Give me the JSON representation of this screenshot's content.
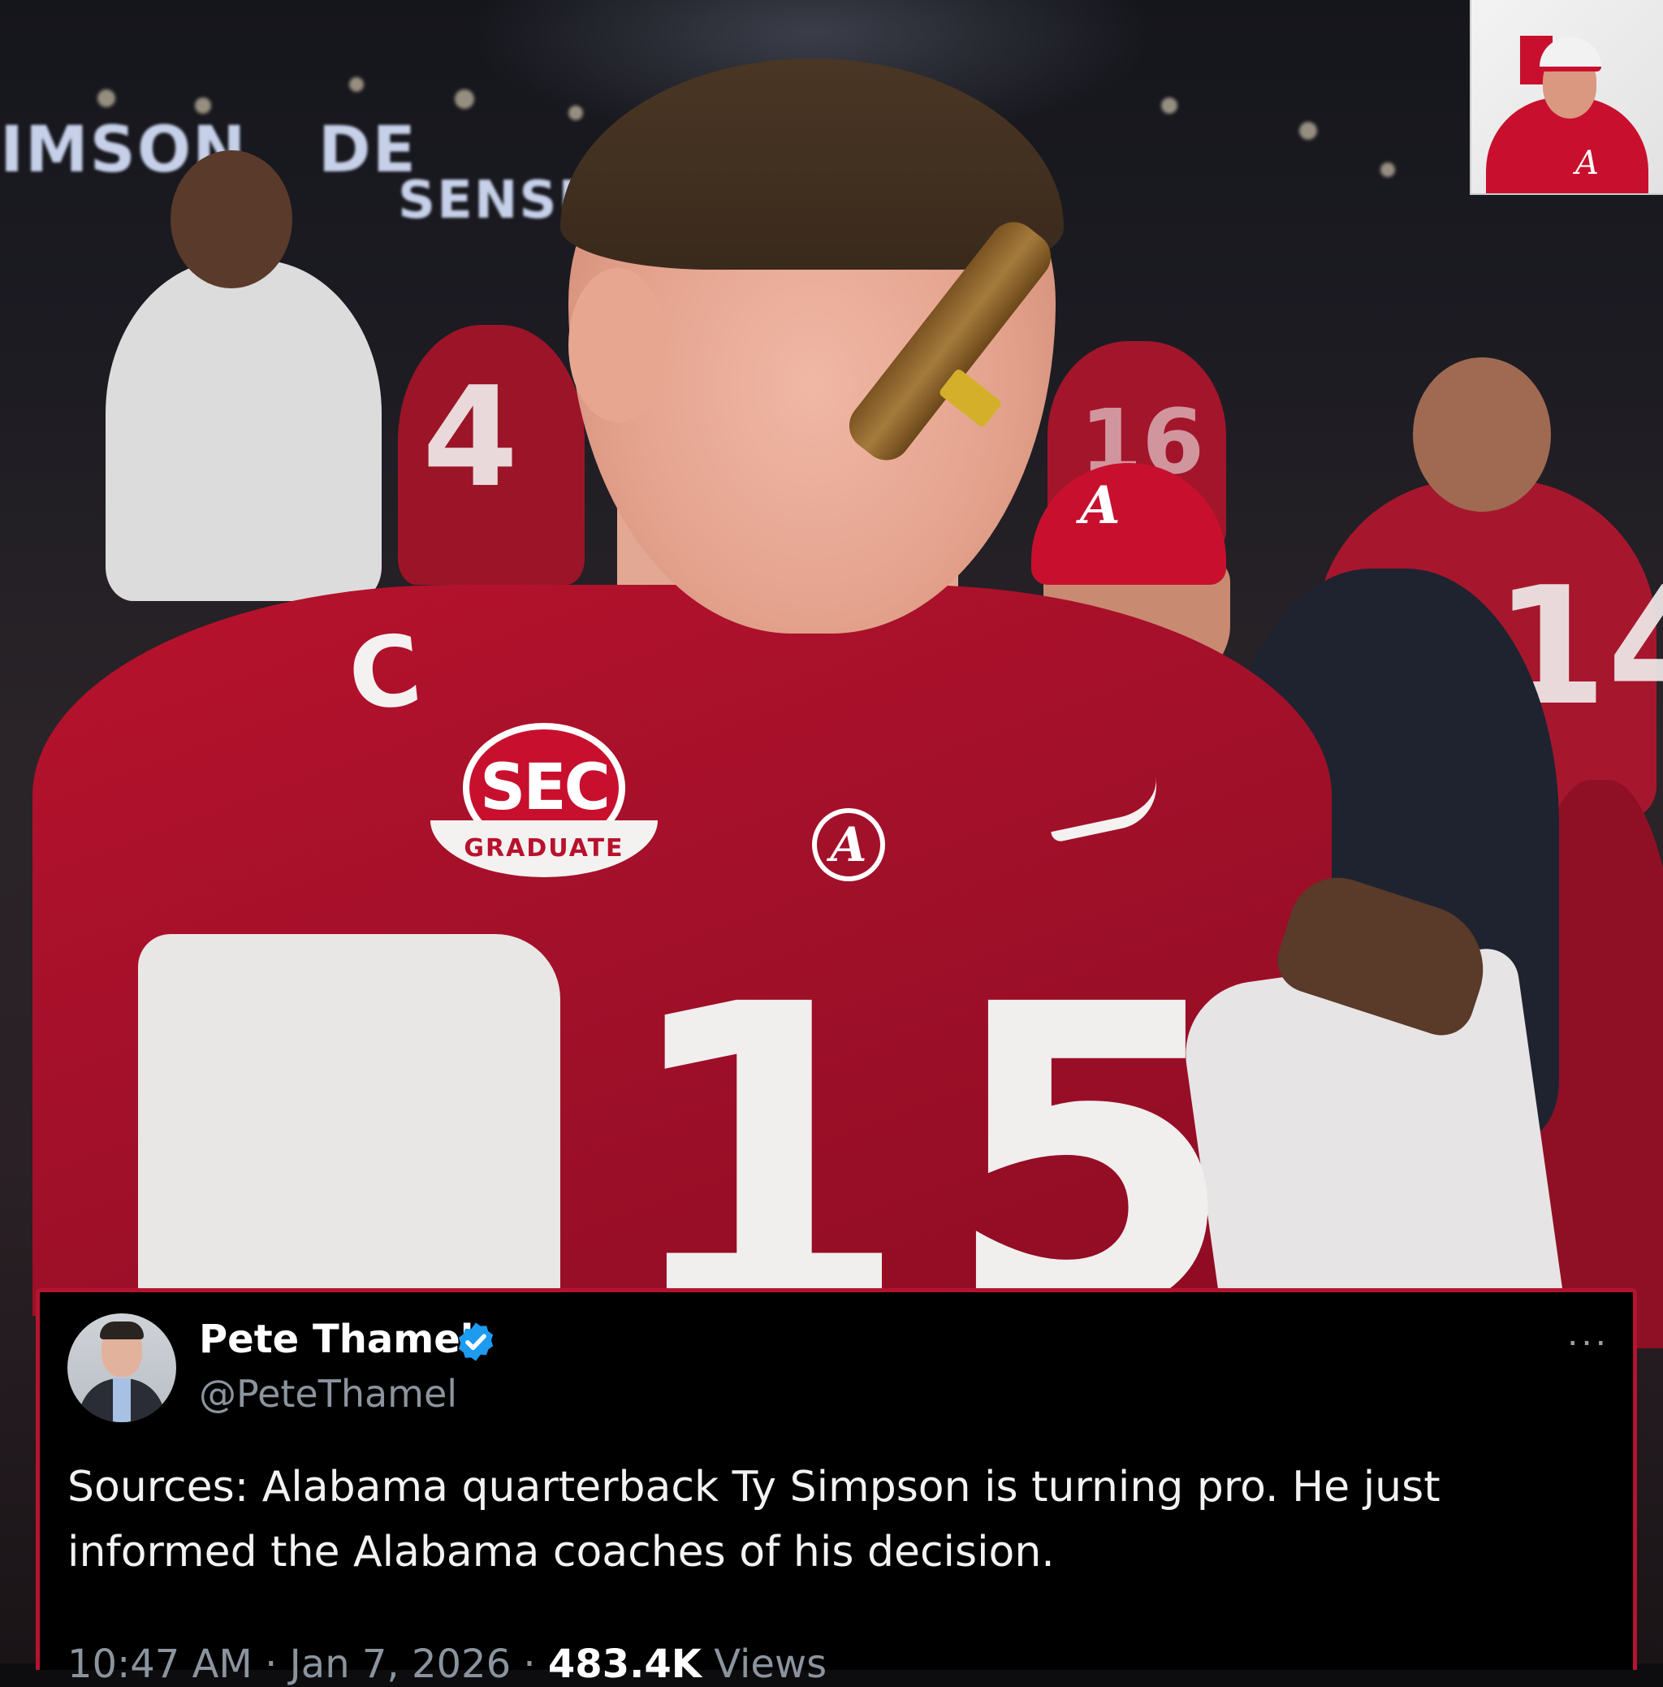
{
  "tweet": {
    "display_name": "Pete Thamel",
    "handle": "@PeteThamel",
    "verified": true,
    "text": "Sources: Alabama quarterback Ty Simpson is turning pro. He just informed the Alabama coaches of his decision.",
    "time": "10:47 AM",
    "separator": "·",
    "date": "Jan 7, 2026",
    "views_count": "483.4K",
    "views_label": "Views",
    "more_icon": "···"
  },
  "photo": {
    "scoreboard_left": "IMSON",
    "scoreboard_left_2": "DE",
    "scoreboard_right": "SENSUS",
    "captain_patch": "C",
    "sec_patch": "SEC",
    "sec_ribbon": "GRADUATE",
    "chest_logo": "A",
    "jersey_number": "15",
    "fan_number_left": "4",
    "fan_number_right": "14",
    "fan_number_mid": "16",
    "coach_cap_logo": "A"
  },
  "colors": {
    "crimson": "#b8122c",
    "tweet_border": "#b5132f",
    "verified_blue": "#1d9bf0",
    "meta_gray": "#8b949e"
  },
  "icons": {
    "verified": "verified-badge-icon",
    "more": "more-icon"
  }
}
